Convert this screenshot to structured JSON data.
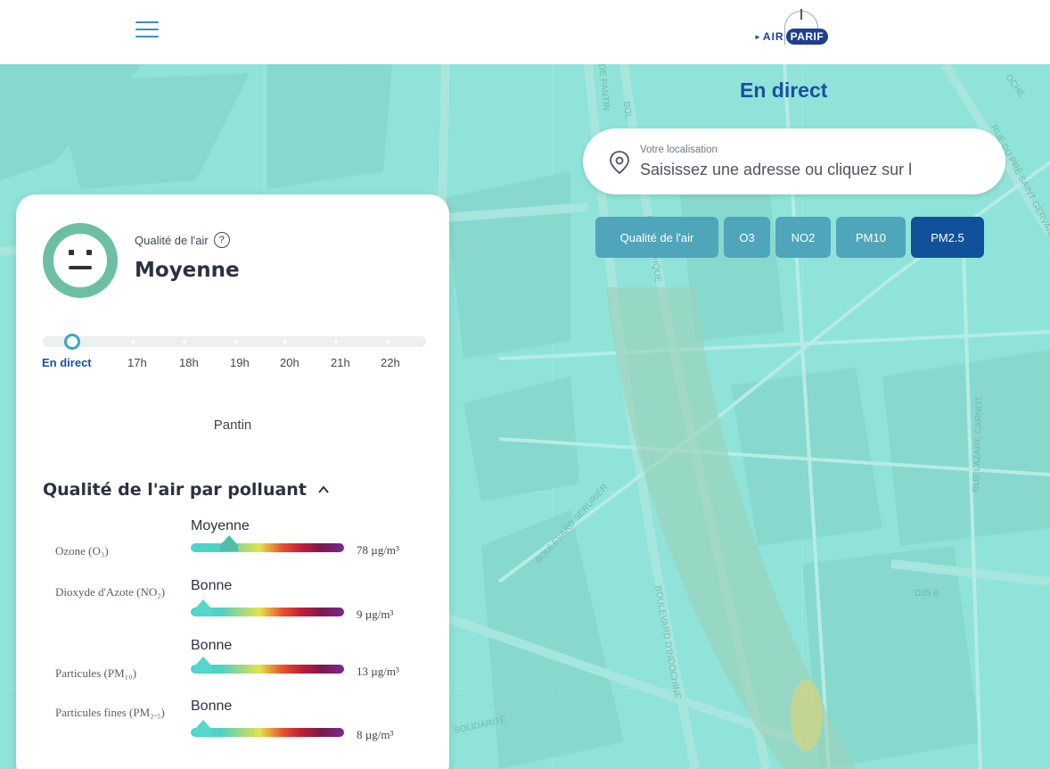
{
  "header": {
    "menu_icon": "hamburger-icon",
    "logo_air": "AIR",
    "logo_parif": "PARIF"
  },
  "page": {
    "title": "En direct"
  },
  "search": {
    "label": "Votre localisation",
    "placeholder": "Saisissez une adresse ou cliquez sur l",
    "icon": "location-pin-icon"
  },
  "tabs": [
    {
      "label": "Qualité de l'air",
      "active": false
    },
    {
      "label": "O3",
      "active": false
    },
    {
      "label": "NO2",
      "active": false
    },
    {
      "label": "PM10",
      "active": false
    },
    {
      "label": "PM2.5",
      "active": true
    }
  ],
  "panel": {
    "quality_label": "Qualité de l'air",
    "help_symbol": "?",
    "quality_value": "Moyenne",
    "face_icon": "neutral-face-icon",
    "timeline": [
      "En direct",
      "17h",
      "18h",
      "19h",
      "20h",
      "21h",
      "22h"
    ],
    "location": "Pantin",
    "section_title": "Qualité de l'air par polluant",
    "pollutants": [
      {
        "name": "Ozone (O₃)",
        "rating": "Moyenne",
        "value": "78 µg/m³",
        "level": 0.25
      },
      {
        "name": "Dioxyde d'Azote (NO₂)",
        "rating": "Bonne",
        "value": "9 µg/m³",
        "level": 0.08
      },
      {
        "name": "Particules (PM₁₀)",
        "rating": "Bonne",
        "value": "13 µg/m³",
        "level": 0.08
      },
      {
        "name": "Particules fines (PM₂.₅)",
        "rating": "Bonne",
        "value": "8 µg/m³",
        "level": 0.08
      }
    ]
  },
  "map": {
    "streets": [
      "BOULEVARD SERURIER",
      "PÉRIPHÉRIQUE",
      "RUE LAZARE CARNOT",
      "BOULEVARD D'INDOCHINE",
      "D35 B",
      "SOLIDARITÉ",
      "RUE DU PRÉ SAINT-GERVAIS",
      "BOL",
      "DE PANTIN",
      "OCHE"
    ]
  },
  "colors": {
    "accent": "#1c4fa0",
    "map": "#8fe3d8",
    "tab": "#4fa6bb",
    "tab_active": "#11519a",
    "face": "#6dbfa3"
  }
}
